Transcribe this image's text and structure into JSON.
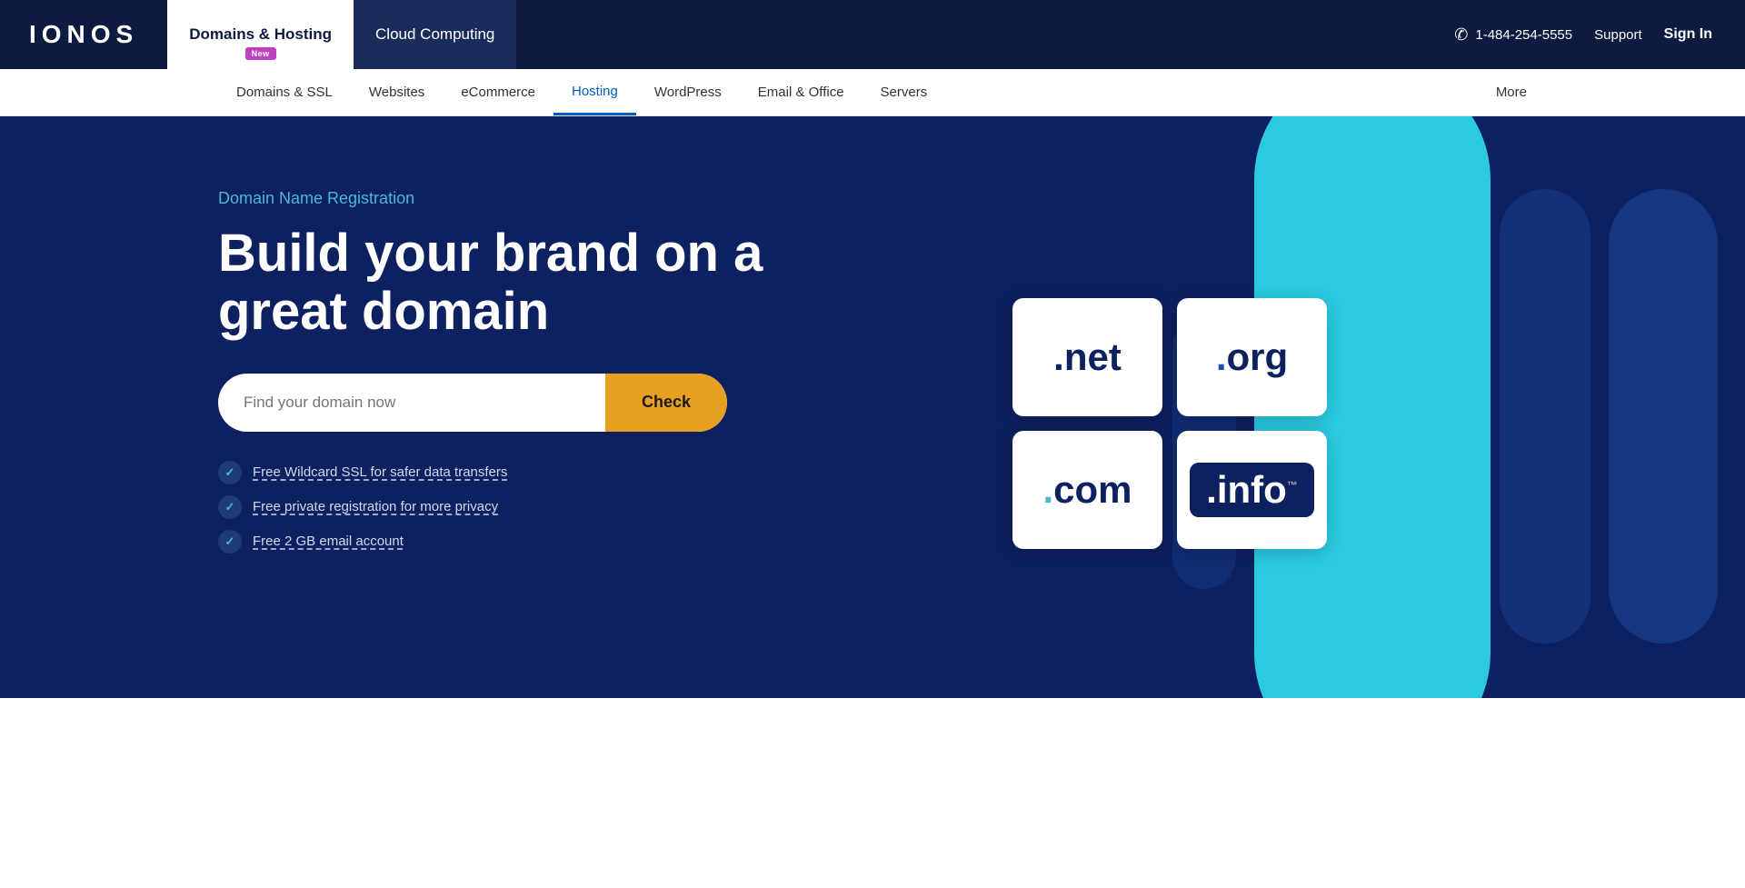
{
  "logo": "IONOS",
  "topnav": {
    "tabs": [
      {
        "id": "domains-hosting",
        "label": "Domains & Hosting",
        "active": true,
        "badge": "New"
      },
      {
        "id": "cloud-computing",
        "label": "Cloud Computing",
        "active": false
      }
    ],
    "phone": "1-484-254-5555",
    "support": "Support",
    "signin": "Sign In"
  },
  "subnav": {
    "items": [
      {
        "id": "domains-ssl",
        "label": "Domains & SSL",
        "active": false
      },
      {
        "id": "websites",
        "label": "Websites",
        "active": false
      },
      {
        "id": "ecommerce",
        "label": "eCommerce",
        "active": false
      },
      {
        "id": "hosting",
        "label": "Hosting",
        "active": true
      },
      {
        "id": "wordpress",
        "label": "WordPress",
        "active": false
      },
      {
        "id": "email-office",
        "label": "Email & Office",
        "active": false
      },
      {
        "id": "servers",
        "label": "Servers",
        "active": false
      }
    ],
    "more": "More"
  },
  "hero": {
    "subtitle": "Domain Name Registration",
    "title": "Build your brand on a great domain",
    "search_placeholder": "Find your domain now",
    "search_button": "Check",
    "features": [
      {
        "id": "ssl",
        "text": "Free Wildcard SSL for safer data transfers"
      },
      {
        "id": "privacy",
        "text": "Free private registration for more privacy"
      },
      {
        "id": "email",
        "text": "Free 2 GB email account"
      }
    ]
  },
  "domain_tiles": [
    {
      "id": "net",
      "label": ".net",
      "type": "net"
    },
    {
      "id": "org",
      "label": ".org",
      "type": "org"
    },
    {
      "id": "com",
      "label": ".com",
      "type": "com"
    },
    {
      "id": "info",
      "label": ".info",
      "type": "info"
    }
  ],
  "colors": {
    "brand_dark": "#0d2060",
    "brand_accent": "#4db8d4",
    "nav_dark": "#0d1b40",
    "search_button": "#e8a020",
    "badge_purple": "#c040c0"
  }
}
